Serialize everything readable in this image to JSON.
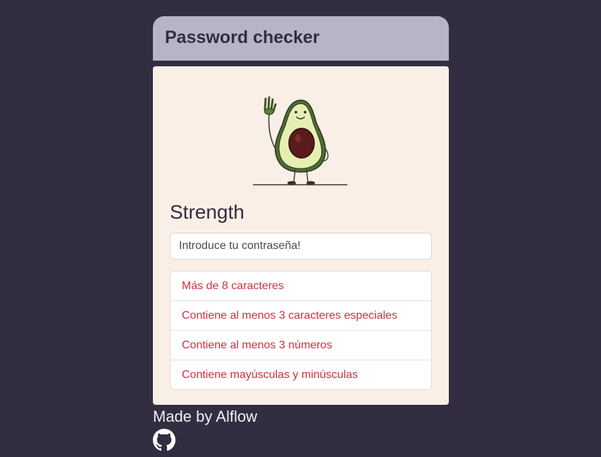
{
  "header": {
    "title": "Password checker"
  },
  "card": {
    "illustration": "waving-avocado-illustration",
    "heading": "Strength",
    "password_input": {
      "placeholder": "Introduce tu contraseña!",
      "value": ""
    },
    "rules": [
      {
        "label": "Más de 8 caracteres",
        "status": "unmet"
      },
      {
        "label": "Contiene al menos 3 caracteres especiales",
        "status": "unmet"
      },
      {
        "label": "Contiene al menos 3 números",
        "status": "unmet"
      },
      {
        "label": "Contiene mayúsculas y minúsculas",
        "status": "unmet"
      }
    ]
  },
  "footer": {
    "credit": "Made by Alflow",
    "github_icon": "github-icon"
  },
  "colors": {
    "background": "#332d42",
    "header": "#b9b3c8",
    "card": "#faefe6",
    "rule_unmet": "#d0303f"
  }
}
